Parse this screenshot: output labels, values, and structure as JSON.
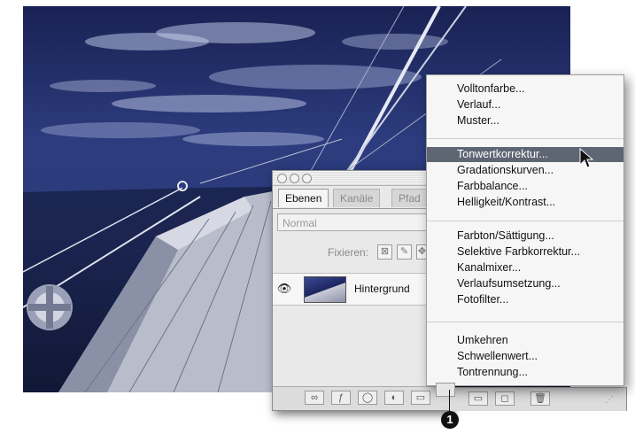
{
  "layers_panel": {
    "tabs": [
      "Ebenen",
      "Kanäle",
      "Pfad"
    ],
    "blend_mode": "Normal",
    "lock_label": "Fixieren:",
    "layer_name": "Hintergrund"
  },
  "adjustment_menu": {
    "items": [
      "Volltonfarbe...",
      "Verlauf...",
      "Muster...",
      "Tonwertkorrektur...",
      "Gradationskurven...",
      "Farbbalance...",
      "Helligkeit/Kontrast...",
      "Farbton/Sättigung...",
      "Selektive Farbkorrektur...",
      "Kanalmixer...",
      "Verlaufsumsetzung...",
      "Fotofilter...",
      "Umkehren",
      "Schwellenwert...",
      "Tontrennung..."
    ],
    "highlighted": "Tonwertkorrektur..."
  },
  "callout_number": "1",
  "icons": [
    "eye-icon",
    "lock-transparent-icon",
    "lock-paint-icon",
    "link-icon",
    "layer-style-icon",
    "mask-icon",
    "adjustment-layer-icon",
    "folder-icon",
    "new-layer-icon",
    "trash-icon",
    "resize-grip-icon",
    "pointer-cursor-icon"
  ],
  "colors": {
    "menu_highlight": "#5f6673",
    "sky_dark": "#1a2254"
  }
}
